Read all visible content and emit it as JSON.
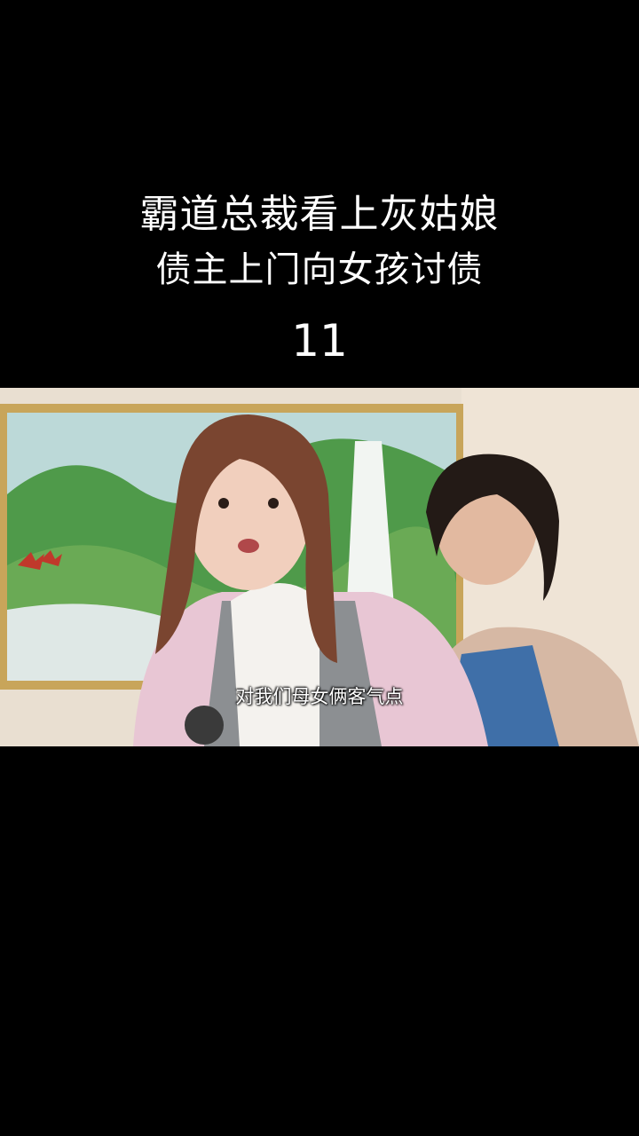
{
  "title": {
    "line1": "霸道总裁看上灰姑娘",
    "line2": "债主上门向女孩讨债",
    "episode": "11"
  },
  "video": {
    "subtitle": "对我们母女俩客气点",
    "scene_description_icon": "video-still"
  },
  "colors": {
    "background": "#000000",
    "text": "#ffffff"
  }
}
